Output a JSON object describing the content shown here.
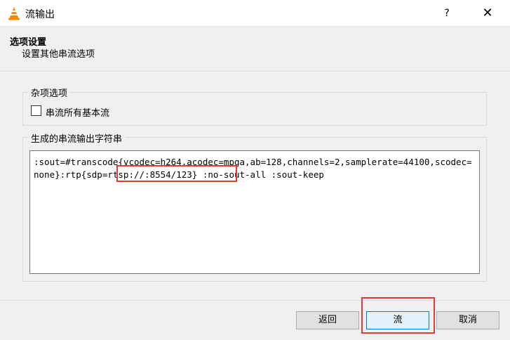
{
  "window": {
    "title": "流输出",
    "help_label": "?",
    "close_label": "✕"
  },
  "header": {
    "title": "选项设置",
    "subtitle": "设置其他串流选项"
  },
  "misc_group": {
    "title": "杂项选项",
    "checkbox_label": "串流所有基本流",
    "checkbox_checked": false
  },
  "output_group": {
    "title": "生成的串流输出字符串",
    "value": ":sout=#transcode{vcodec=h264,acodec=mpga,ab=128,channels=2,samplerate=44100,scodec=none}:rtp{sdp=rtsp://:8554/123} :no-sout-all :sout-keep"
  },
  "buttons": {
    "back": "返回",
    "stream": "流",
    "cancel": "取消"
  },
  "colors": {
    "annotation": "#e53935",
    "accent": "#0078d7"
  }
}
